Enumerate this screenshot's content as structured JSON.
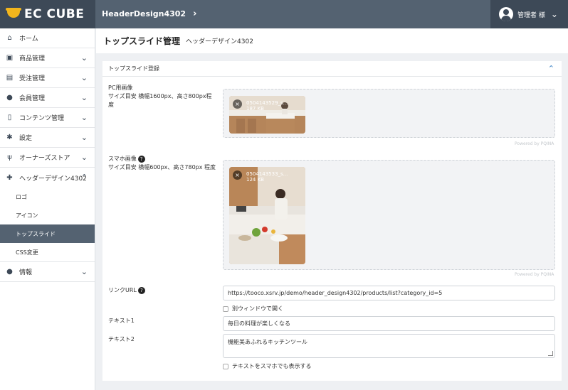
{
  "header": {
    "logo_text": "EC CUBE",
    "breadcrumb": "HeaderDesign4302",
    "user_name": "管理者 様"
  },
  "sidebar": {
    "items": [
      {
        "label": "ホーム",
        "icon": "home-icon"
      },
      {
        "label": "商品管理",
        "icon": "box-icon"
      },
      {
        "label": "受注管理",
        "icon": "cart-icon"
      },
      {
        "label": "会員管理",
        "icon": "users-icon"
      },
      {
        "label": "コンテンツ管理",
        "icon": "file-icon"
      },
      {
        "label": "設定",
        "icon": "gear-icon"
      },
      {
        "label": "オーナーズストア",
        "icon": "plug-icon"
      },
      {
        "label": "ヘッダーデザイン4302",
        "icon": "puzzle-icon"
      }
    ],
    "sub_items": [
      "ロゴ",
      "アイコン",
      "トップスライド",
      "CSS変更"
    ],
    "last_item": {
      "label": "情報",
      "icon": "info-icon"
    }
  },
  "page": {
    "title": "トップスライド管理",
    "subtitle": "ヘッダーデザイン4302"
  },
  "form": {
    "card_title": "トップスライド登録",
    "pc_label": "PC用画像",
    "pc_note": "サイズ目安 横幅1600px、高さ800px程度",
    "pc_file": "0504143529_s...",
    "pc_file_size": "187 KB",
    "sp_label": "スマホ画像",
    "sp_note": "サイズ目安 横幅600px、高さ780px 程度",
    "sp_file": "0504143533_s...",
    "sp_file_size": "124 KB",
    "powered": "Powered by PQINA",
    "link_label": "リンクURL",
    "link_value": "https://tooco.xsrv.jp/demo/header_design4302/products/list?category_id=5",
    "new_window_label": "別ウィンドウで開く",
    "text1_label": "テキスト1",
    "text1_value": "毎日の料理が楽しくなる",
    "text2_label": "テキスト2",
    "text2_value": "機能美あふれるキッチンツール",
    "sp_show_label": "テキストをスマホでも表示する"
  }
}
